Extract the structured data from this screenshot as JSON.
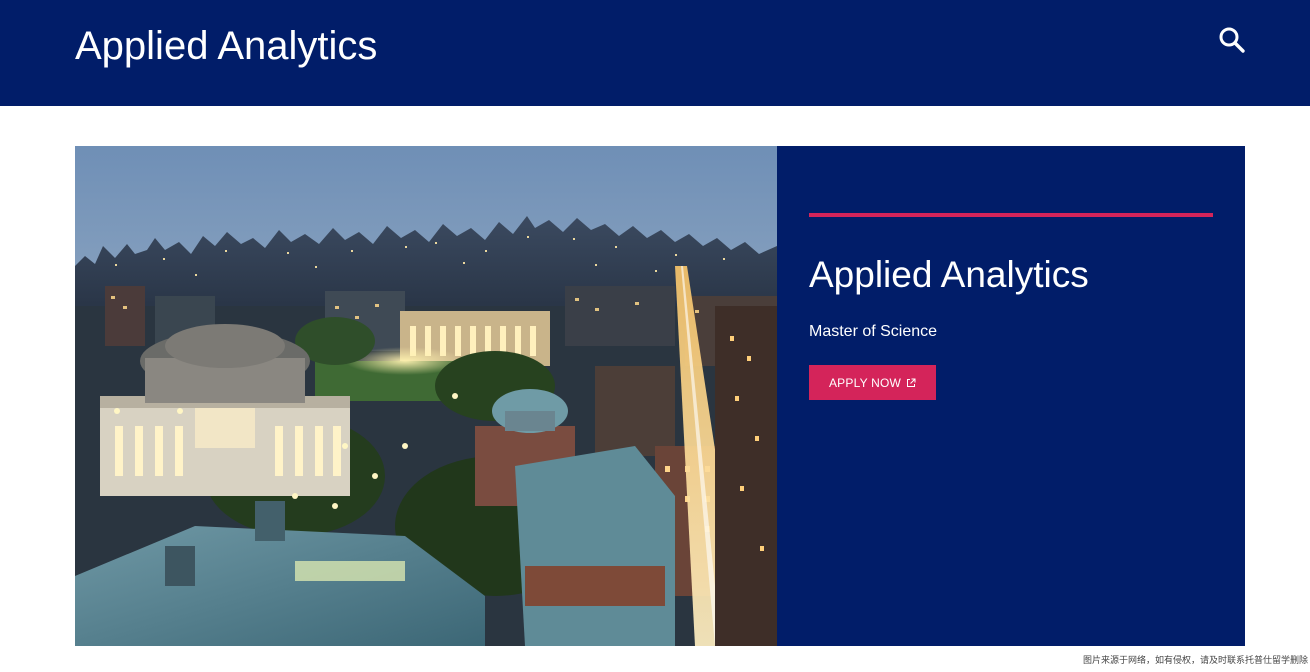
{
  "header": {
    "site_title": "Applied Analytics",
    "search_icon": "search-icon"
  },
  "hero": {
    "image_description": "",
    "program_title": "Applied Analytics",
    "degree": "Master of Science",
    "apply_label": "APPLY NOW",
    "apply_icon": "external-link-icon"
  },
  "footer": {
    "note": "图片来源于网络，如有侵权，请及时联系托普仕留学删除"
  },
  "colors": {
    "navy": "#011d69",
    "accent": "#d4245a",
    "white": "#ffffff"
  }
}
